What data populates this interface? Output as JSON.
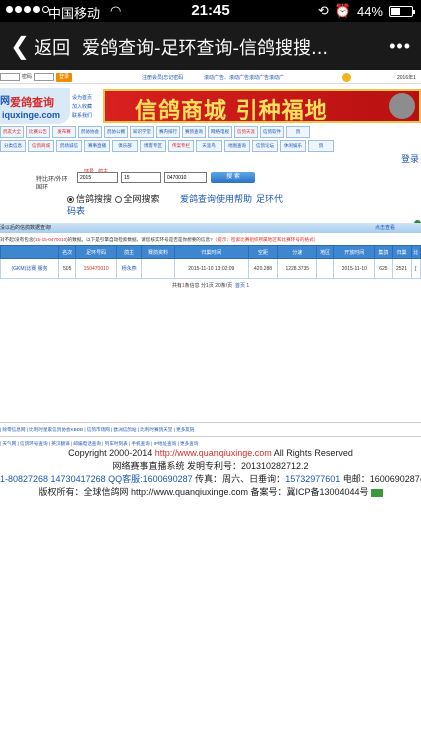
{
  "status_bar": {
    "carrier": "中国移动",
    "time": "21:45",
    "battery": "44%",
    "battery_level": 0.44
  },
  "navbar": {
    "back_label": "返回",
    "title": "爱鸽查询-足环查询-信鸽搜搜...",
    "more": "•••"
  },
  "top_strip": {
    "password_label": "密码",
    "login_button": "登录",
    "links": "注册会员|忘记密码",
    "promo": "滚动广告、滚动广告滚动广告滚动广",
    "date": "2016年1"
  },
  "logo": {
    "line1": "爱鸽查询",
    "prefix": "网",
    "domain": "iquxinge.com"
  },
  "side_links": [
    "设为首页",
    "加入收藏",
    "联系我们"
  ],
  "banner": {
    "text": "信鸽商城  引种福地"
  },
  "menu": {
    "row1": [
      "鸽友大全",
      "比赛公告",
      "发布赛",
      "鸽协协会",
      "鸽协公棚",
      "知识学堂",
      "赛内排行",
      "赛鸽查询",
      "网络电视",
      "信鸽天涯",
      "信鸽软件",
      "鸽"
    ],
    "row2": [
      "分类信息",
      "信鸽商城",
      "鸽场诚信",
      "赛事直播",
      "俱乐部",
      "博客专区",
      "传案专栏",
      "天涯鸟",
      "地图查询",
      "信鸽论坛",
      "休闲娱乐",
      "鸽"
    ]
  },
  "login_link": "登录",
  "search": {
    "ring_label": "特比环/外环",
    "country_label": "国环",
    "hint_year": "环号",
    "hint_province": "鸽主",
    "year_value": "2015",
    "region_value": "15",
    "ring_value": "0470010",
    "button": "搜 索",
    "radio1": "信鸽搜搜",
    "radio2": "全网搜索",
    "help_link": "爱鸽查询使用帮助",
    "ring_code_link": "足环代",
    "ring_code_link2": "码表"
  },
  "result_bar": {
    "left": "没以后的信鸽数据查询!",
    "right": "点击查看"
  },
  "notice": {
    "prefix": "对不起!没有包含(",
    "query": "15-15-0470010",
    "middle": ")的数据。以下是引擎自动检索数据，请您核实环号是否是你想要的信息?",
    "tip": "（提示：检索比赛组织所属地区和比赛环号的格式）"
  },
  "table": {
    "headers": [
      "",
      "名次",
      "足环号码",
      "鸽主",
      "赛鸽资料",
      "归巢时间",
      "空距",
      "分速",
      "地区",
      "开放时间",
      "集鸽",
      "归巢",
      "比"
    ],
    "rows": [
      [
        "(GKM)比赛 服务",
        "505",
        "150470010",
        "杨永燕",
        "",
        "2015-11-10 13:02:09",
        "420.288",
        "1228.3735",
        "",
        "2015-11-10",
        "625",
        "2521",
        "["
      ]
    ]
  },
  "pager": {
    "prefix": "共有",
    "count": "1",
    "suffix": "条信息 分",
    "page_count": "1",
    "per_page": "页 20条/页",
    "home": "首页",
    "page": "1"
  },
  "footer_links": {
    "line1": "| 除零信息网 | 比利时星家信鸽协会KBDB | 信鸽市场网 | 欧洲信鸽站 | 比利时赛鸽天堂 | 更多友链",
    "line2": "| 天气网 | 信鸽环号查询 | 英汉翻译 | 邮编电话查询 | 列车时刻表 | 手机查询 | IP地址查询 | 更多查询"
  },
  "footer": {
    "copyright_prefix": "Copyright 2000-2014 ",
    "copyright_url": "http://www.quanqiuxinge.com",
    "copyright_suffix": " All Rights Reserved",
    "patent": "网络赛事直播系统 发明专利号：201310282712.2",
    "phones_prefix": "1-80827268 14730417268",
    "qq": " QQ客服:1600690287",
    "fax": " 传真：周六、日垂询：",
    "fax_number": "15732977601",
    "email": " 电邮：1600690287@pp.c",
    "owner": "版权所有：全球信鸽网 http://www.quanqiuxinge.com 备案号：冀ICP备13004044号"
  }
}
